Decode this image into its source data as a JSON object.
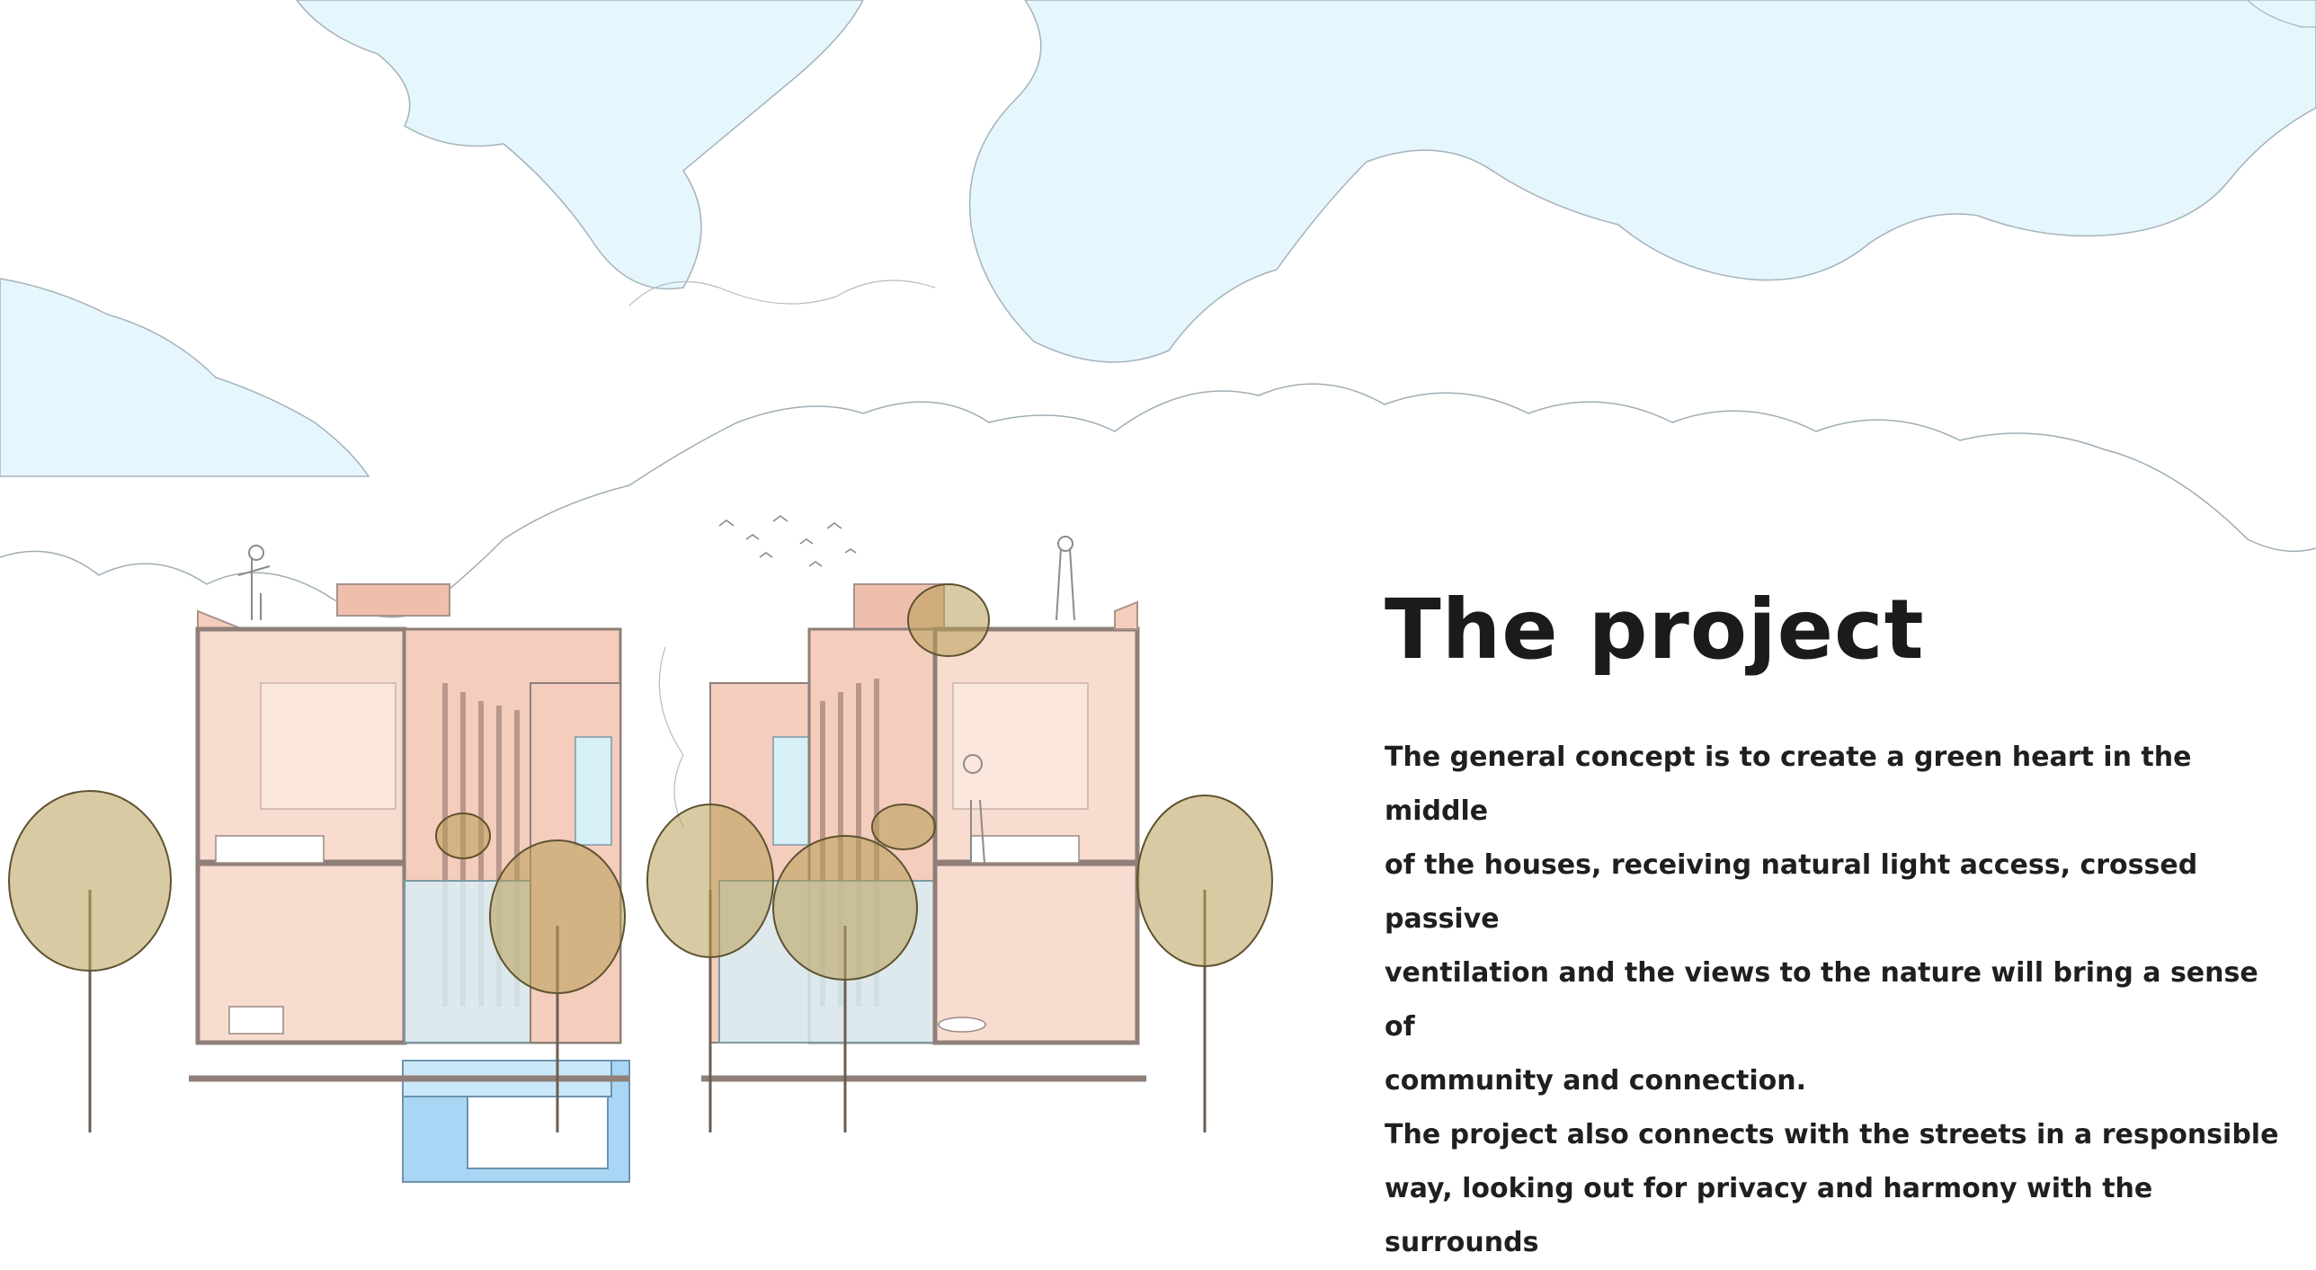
{
  "heading": "The project",
  "body_lines": [
    "The general concept is to create a green heart in the middle",
    "of the houses, receiving natural light access, crossed passive",
    "ventilation and the views to the nature will bring a sense of",
    "community and connection.",
    "The project  also connects with the streets in a responsible",
    "way, looking out for privacy and harmony with the surrounds"
  ],
  "colors": {
    "sky_blue": "#e5f6fd",
    "cloud_outline": "#8e9aa2",
    "building_pink": "#f4cdbd",
    "building_wall": "#8f7f78",
    "tree_foliage": "#b89f56",
    "water_blue": "#a9d6f5",
    "glass_blue": "#d7f0f7",
    "heading_text": "#1b1b1b"
  },
  "illustration": {
    "subject": "architectural sketch of two mirrored houses with central garden courtyard, trees, birds and pool"
  }
}
